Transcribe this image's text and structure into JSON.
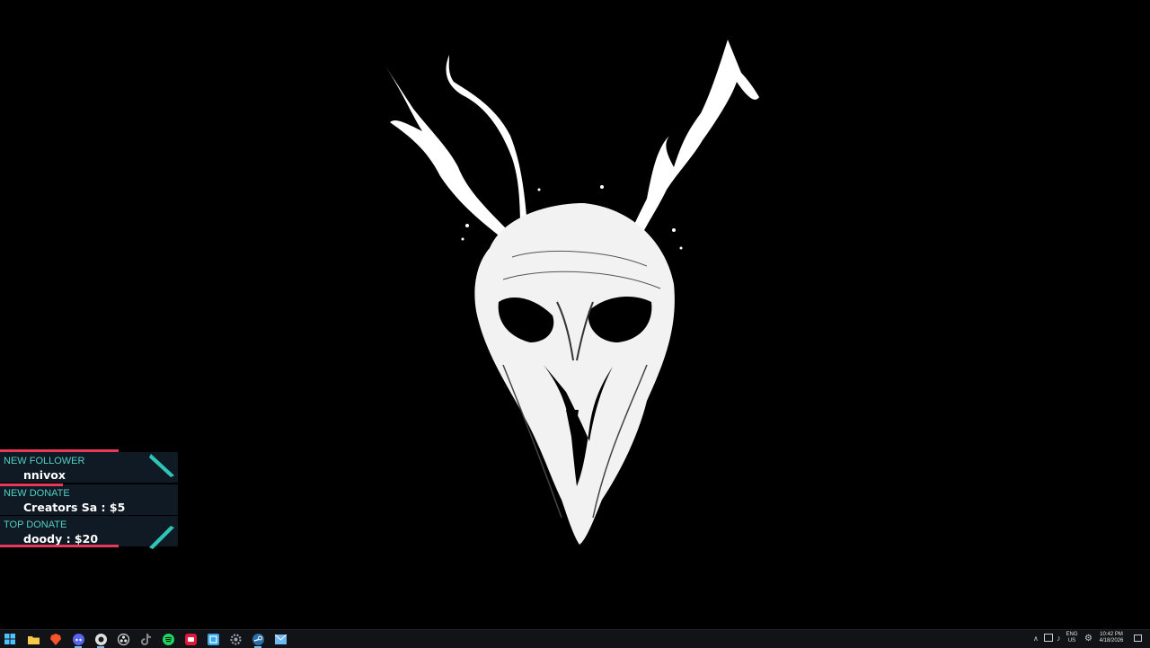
{
  "overlay": {
    "follower": {
      "label": "NEW FOLLOWER",
      "value": "nnivox"
    },
    "donate": {
      "label": "NEW DONATE",
      "value": "Creators Sa : $5"
    },
    "top_donate": {
      "label": "TOP DONATE",
      "value": "doody : $20"
    }
  },
  "taskbar": {
    "apps": [
      "start-icon",
      "file-explorer-icon",
      "brave-browser-icon",
      "discord-icon",
      "chrome-icon",
      "obs-icon",
      "tiktok-icon",
      "spotify-icon",
      "streamlabs-icon",
      "snipping-tool-icon",
      "settings-icon",
      "steam-icon",
      "mail-icon"
    ],
    "tray": {
      "language": "ENG",
      "region": "US",
      "time": "10:42 PM",
      "date": "4/18/2026"
    }
  },
  "colors": {
    "accent_teal": "#2ec4b6",
    "accent_pink": "#e8395a",
    "overlay_bg": "#101a24"
  }
}
